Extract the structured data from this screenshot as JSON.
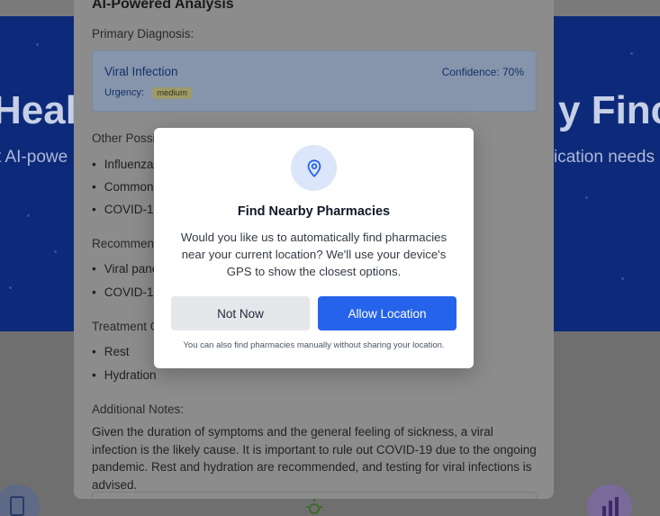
{
  "hero": {
    "title_left": "Healt",
    "title_right": "y Finc",
    "sub_left": "t AI-powe",
    "sub_right": "ication needs"
  },
  "analysis": {
    "title": "AI-Powered Analysis",
    "primary_label": "Primary Diagnosis:",
    "diagnosis": "Viral Infection",
    "confidence": "Confidence: 70%",
    "urgency_label": "Urgency:",
    "urgency_value": "medium",
    "other_label": "Other Possib",
    "other_items": [
      "Influenza",
      "Common",
      "COVID-1"
    ],
    "recommend_label": "Recommend",
    "recommend_items": [
      "Viral pane",
      "COVID-1"
    ],
    "treatment_label": "Treatment O",
    "treatment_items": [
      "Rest",
      "Hydration"
    ],
    "notes_label": "Additional Notes:",
    "notes_text": "Given the duration of symptoms and the general feeling of sickness, a viral infection is the likely cause. It is important to rule out COVID-19 due to the ongoing pandemic. Rest and hydration are recommended, and testing for viral infections is advised."
  },
  "modal": {
    "icon": "map-pin-icon",
    "title": "Find Nearby Pharmacies",
    "text": "Would you like us to automatically find pharmacies near your current location? We'll use your device's GPS to show the closest options.",
    "not_now": "Not Now",
    "allow": "Allow Location",
    "footnote": "You can also find pharmacies manually without sharing your location."
  },
  "colors": {
    "accent": "#2563eb",
    "hero_bg": "#0d2a7a",
    "overlay": "#6b6b6b"
  }
}
